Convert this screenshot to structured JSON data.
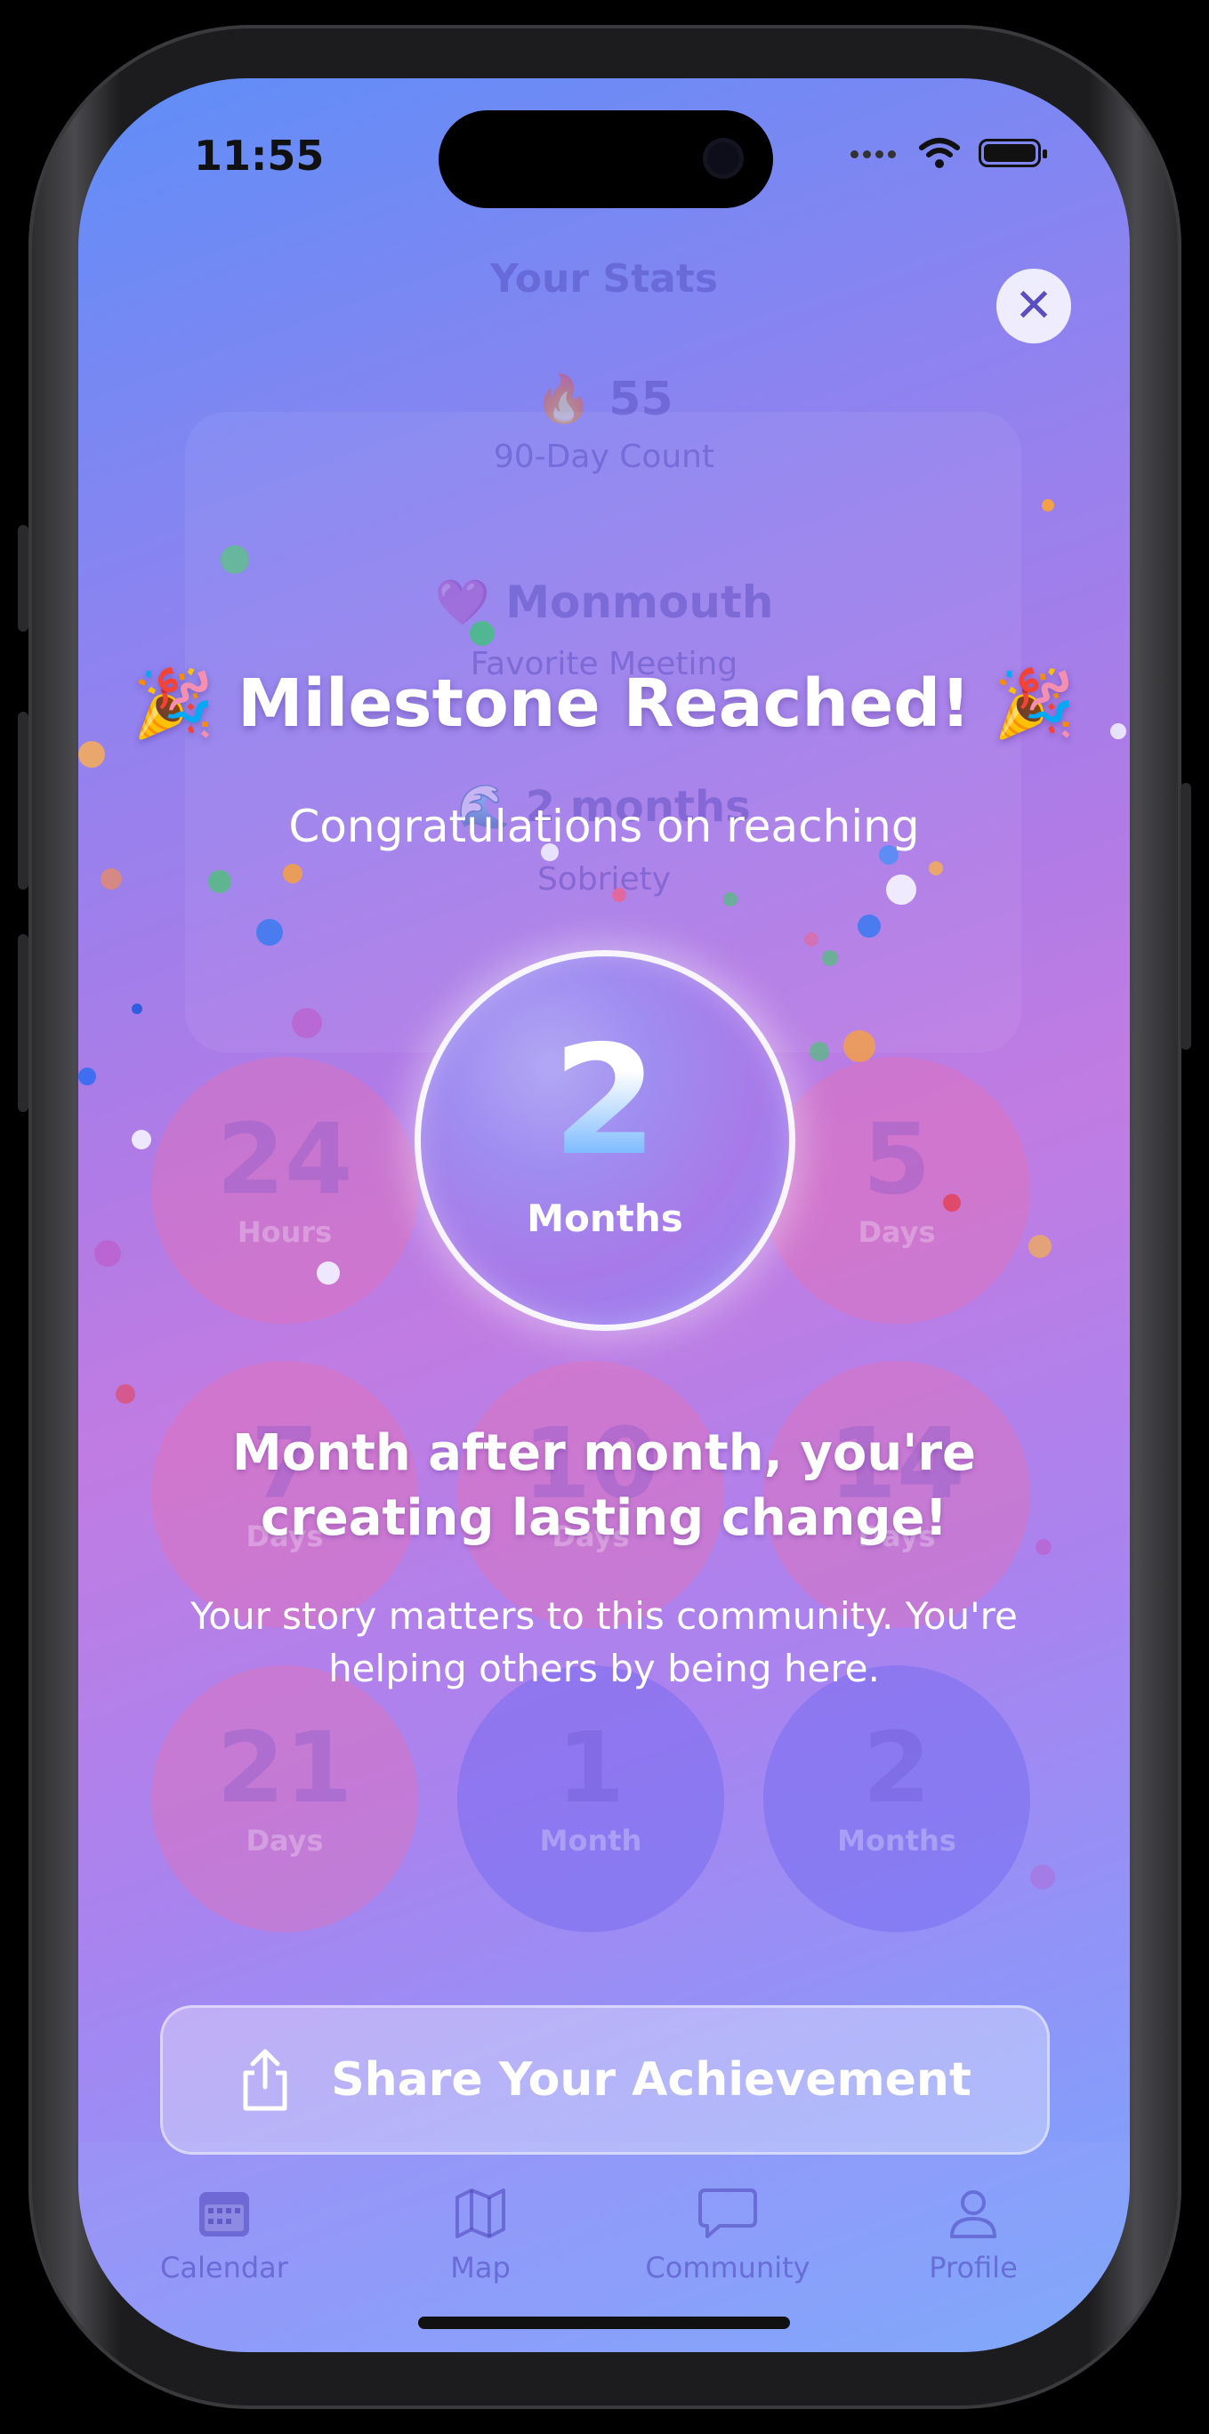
{
  "status": {
    "time": "11:55"
  },
  "close": {
    "label": "✕"
  },
  "background_stats": {
    "title": "Your Stats",
    "count_value": "55",
    "count_label": "90-Day Count",
    "favorite_value": "Monmouth",
    "favorite_label": "Favorite Meeting",
    "sobriety_value": "2 months",
    "sobriety_label": "Sobriety"
  },
  "background_milestones": [
    {
      "n": "24",
      "u": "Hours"
    },
    {
      "n": "5",
      "u": "Days"
    },
    {
      "n": "7",
      "u": "Days"
    },
    {
      "n": "10",
      "u": "Days"
    },
    {
      "n": "14",
      "u": "Days"
    },
    {
      "n": "21",
      "u": "Days"
    },
    {
      "n": "1",
      "u": "Month"
    },
    {
      "n": "2",
      "u": "Months"
    }
  ],
  "milestone": {
    "headline": "🎉 Milestone Reached! 🎉",
    "subhead": "Congratulations on reaching",
    "number": "2",
    "unit": "Months",
    "message": "Month after month, you're creating lasting change!",
    "submessage": "Your story matters to this community. You're helping others by being here."
  },
  "share": {
    "label": "Share Your Achievement"
  },
  "tabs": [
    {
      "label": "Calendar",
      "icon": "calendar-icon"
    },
    {
      "label": "Map",
      "icon": "map-icon"
    },
    {
      "label": "Community",
      "icon": "chat-bubble-icon"
    },
    {
      "label": "Profile",
      "icon": "person-icon"
    }
  ],
  "colors": {
    "accent": "#5aa8ff",
    "gradient_top": "#5f8ef7",
    "gradient_mid": "#c07ce2",
    "gradient_bottom": "#78a8fc"
  }
}
